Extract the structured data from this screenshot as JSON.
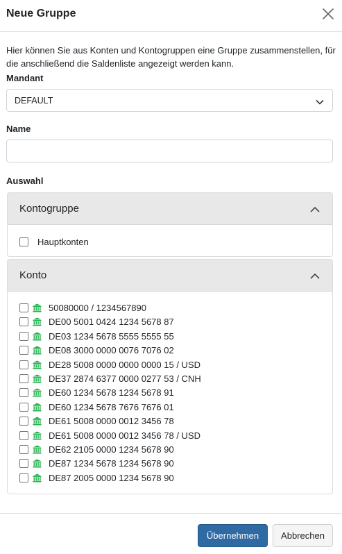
{
  "dialog": {
    "title": "Neue Gruppe",
    "intro": "Hier können Sie aus Konten und Kontogruppen eine Gruppe zusammenstellen, für die anschließend die Saldenliste angezeigt werden kann."
  },
  "form": {
    "mandant_label": "Mandant",
    "mandant_value": "DEFAULT",
    "name_label": "Name",
    "name_value": "",
    "auswahl_label": "Auswahl"
  },
  "kontogruppe": {
    "title": "Kontogruppe",
    "items": [
      "Hauptkonten"
    ]
  },
  "konto": {
    "title": "Konto",
    "items": [
      "50080000 / 1234567890",
      "DE00 5001 0424 1234 5678 87",
      "DE03 1234 5678 5555 5555 55",
      "DE08 3000 0000 0076 7076 02",
      "DE28 5008 0000 0000 0000 15 / USD",
      "DE37 2874 6377 0000 0277 53 / CNH",
      "DE60 1234 5678 1234 5678 91",
      "DE60 1234 5678 7676 7676 01",
      "DE61 5008 0000 0012 3456 78",
      "DE61 5008 0000 0012 3456 78 / USD",
      "DE62 2105 0000 1234 5678 90",
      "DE87 1234 5678 1234 5678 90",
      "DE87 2005 0000 1234 5678 90"
    ]
  },
  "buttons": {
    "apply": "Übernehmen",
    "cancel": "Abbrechen"
  },
  "colors": {
    "primary": "#2f6aa3",
    "bank_icon": "#22b14c",
    "panel_header": "#e8e8e8"
  },
  "icons": {
    "close": "close-icon",
    "chevron_down": "chevron-down-icon",
    "chevron_up": "chevron-up-icon",
    "bank": "bank-icon"
  }
}
